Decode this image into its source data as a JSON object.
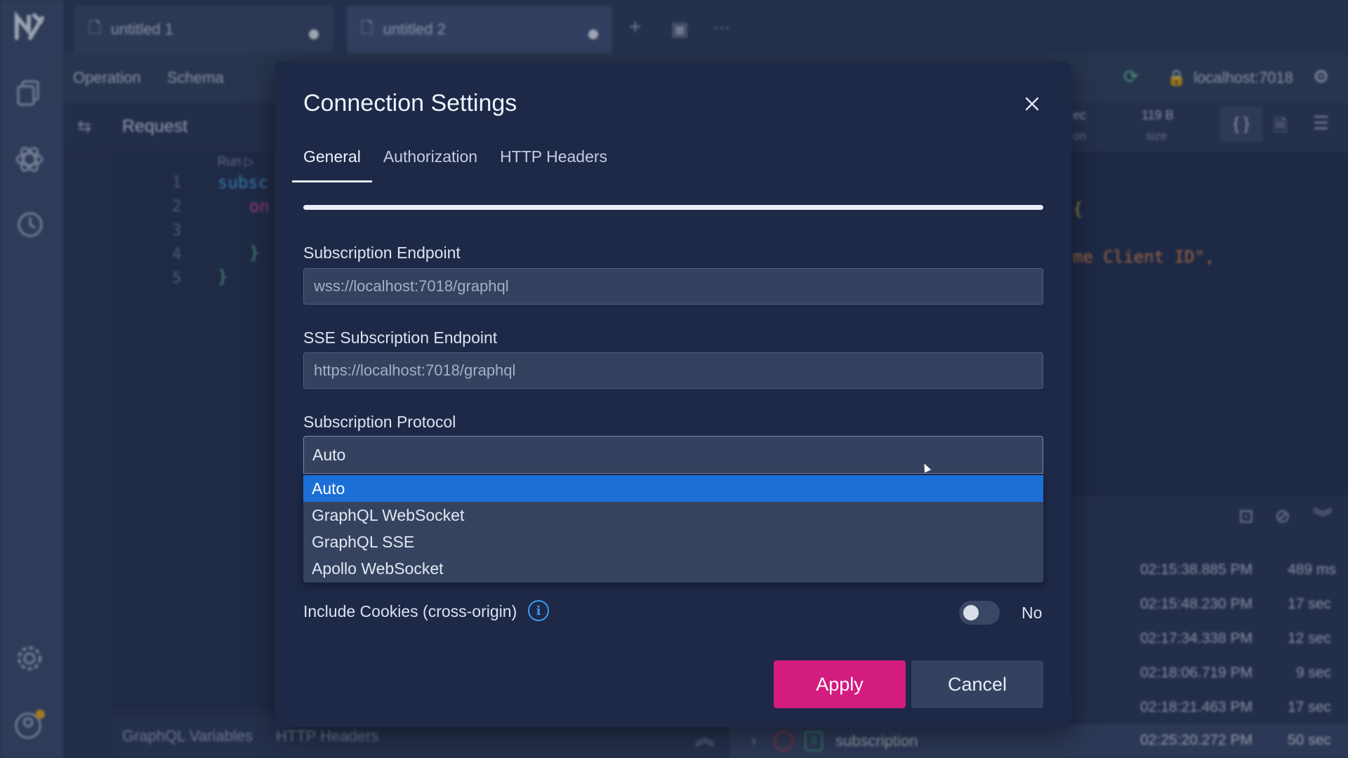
{
  "tabs": [
    {
      "label": "untitled 1",
      "modified": true
    },
    {
      "label": "untitled 2",
      "modified": true
    }
  ],
  "toolbar": {
    "subtabs": [
      "Operation",
      "Schema"
    ],
    "server": "localhost:7018"
  },
  "request": {
    "title": "Request",
    "run_label": "Run ▷",
    "line_numbers": [
      "1",
      "2",
      "3",
      "4",
      "5"
    ],
    "code_fragments": [
      "subsc",
      "on",
      "}",
      "}"
    ]
  },
  "response": {
    "size_value": "119 B",
    "size_label": "size",
    "stat_cut_value": "ec",
    "stat_cut_label": "on",
    "code_fragment": "me Client ID\",",
    "bracket_fragment": "{"
  },
  "log": [
    {
      "time": "02:15:38.885 PM",
      "duration": "489 ms"
    },
    {
      "time": "02:15:48.230 PM",
      "duration": "17 sec"
    },
    {
      "time": "02:17:34.338 PM",
      "duration": "12 sec"
    },
    {
      "time": "02:18:06.719 PM",
      "duration": "9 sec"
    },
    {
      "time": "02:18:21.463 PM",
      "duration": "17 sec"
    },
    {
      "time": "02:25:20.272 PM",
      "duration": "50 sec",
      "name": "subscription"
    }
  ],
  "bottom_tabs": [
    "GraphQL Variables",
    "HTTP Headers"
  ],
  "dialog": {
    "title": "Connection Settings",
    "tabs": [
      "General",
      "Authorization",
      "HTTP Headers"
    ],
    "active_tab": "General",
    "subscription_endpoint": {
      "label": "Subscription Endpoint",
      "placeholder": "wss://localhost:7018/graphql"
    },
    "sse_endpoint": {
      "label": "SSE Subscription Endpoint",
      "placeholder": "https://localhost:7018/graphql"
    },
    "protocol": {
      "label": "Subscription Protocol",
      "selected": "Auto",
      "options": [
        "Auto",
        "GraphQL WebSocket",
        "GraphQL SSE",
        "Apollo WebSocket"
      ]
    },
    "cookies": {
      "label": "Include Cookies (cross-origin)",
      "state_text": "No"
    },
    "apply_label": "Apply",
    "cancel_label": "Cancel"
  },
  "colors": {
    "accent": "#d41c80",
    "selection": "#1b6fd6",
    "info": "#3b9cf0"
  }
}
